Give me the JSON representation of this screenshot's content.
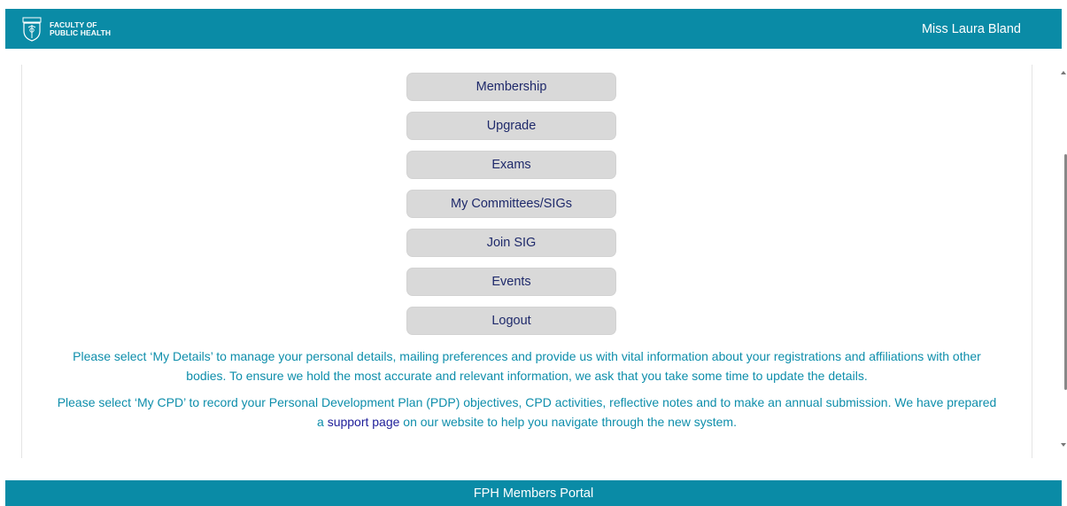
{
  "header": {
    "logo_line1": "FACULTY OF",
    "logo_line2": "PUBLIC HEALTH",
    "user_name": "Miss Laura Bland"
  },
  "menu": {
    "items": [
      {
        "label": "Membership"
      },
      {
        "label": "Upgrade"
      },
      {
        "label": "Exams"
      },
      {
        "label": "My Committees/SIGs"
      },
      {
        "label": "Join SIG"
      },
      {
        "label": "Events"
      },
      {
        "label": "Logout"
      }
    ]
  },
  "info": {
    "details_text": "Please select ‘My Details’ to manage your personal details, mailing preferences and provide us with vital information about your registrations and affiliations with other bodies. To ensure we hold the most accurate and relevant information, we ask that you take some time to update the details.",
    "cpd_text_before": "Please select ‘My CPD’ to record your Personal Development Plan (PDP) objectives, CPD activities, reflective notes and to make an annual submission. We have prepared a ",
    "cpd_link": "support page",
    "cpd_text_after": " on our website to help you navigate through the new system."
  },
  "footer": {
    "label": "FPH Members Portal"
  },
  "colors": {
    "brand_teal": "#0a8ba6",
    "button_grey": "#d9d9d9",
    "button_text": "#1f2a6b",
    "info_text": "#0e8eab",
    "link": "#20209a"
  }
}
